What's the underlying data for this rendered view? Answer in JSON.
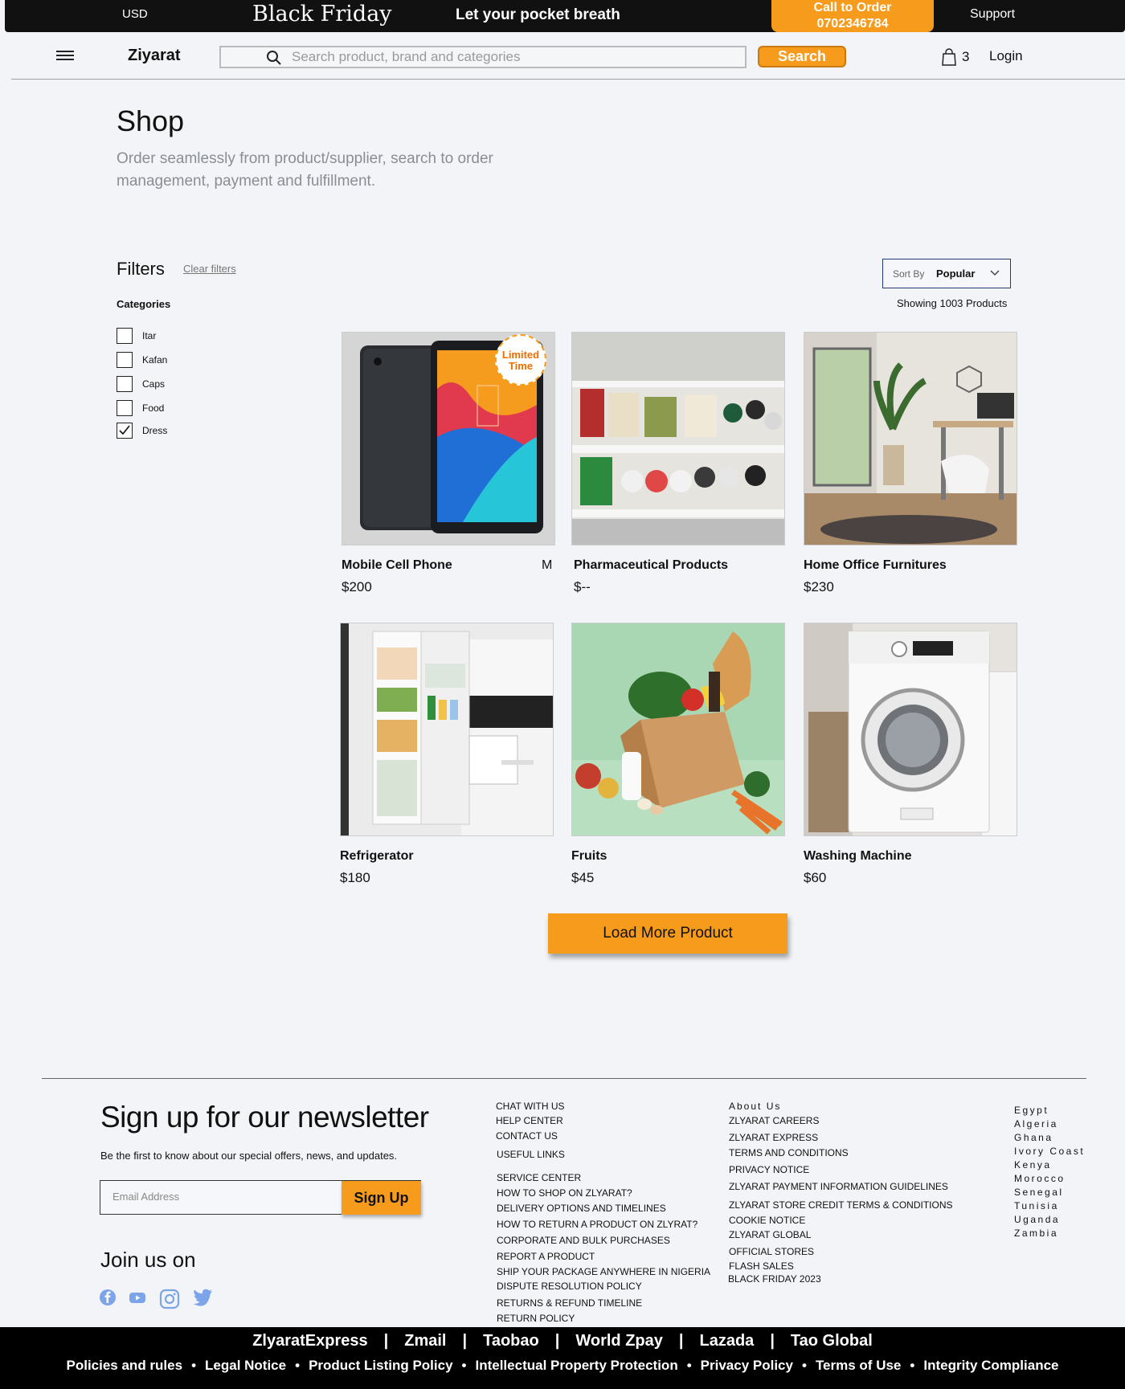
{
  "topbar": {
    "currency": "USD",
    "promo": "Black Friday",
    "tagline": "Let your pocket breath",
    "call_label": "Call to Order",
    "call_number": "0702346784",
    "support": "Support"
  },
  "nav": {
    "brand": "Ziyarat",
    "search_placeholder": "Search product, brand and categories",
    "search_button": "Search",
    "cart_count": "3",
    "login": "Login"
  },
  "hero": {
    "title": "Shop",
    "subtitle": "Order seamlessly from product/supplier, search to order management, payment and fulfillment."
  },
  "filters": {
    "title": "Filters",
    "clear": "Clear filters",
    "categories_title": "Categories",
    "categories": [
      {
        "label": "Itar",
        "checked": false
      },
      {
        "label": "Kafan",
        "checked": false
      },
      {
        "label": "Caps",
        "checked": false
      },
      {
        "label": "Food",
        "checked": false
      },
      {
        "label": "Dress",
        "checked": true
      }
    ]
  },
  "sort": {
    "label": "Sort By",
    "value": "Popular",
    "showing": "Showing 1003 Products"
  },
  "products": [
    {
      "name": "Mobile Cell Phone",
      "price": "$200",
      "extra": "M",
      "badge": "Limited Time"
    },
    {
      "name": "Pharmaceutical Products",
      "price": "$--"
    },
    {
      "name": "Home Office Furnitures",
      "price": "$230"
    },
    {
      "name": "Refrigerator",
      "price": "$180"
    },
    {
      "name": "Fruits",
      "price": "$45"
    },
    {
      "name": "Washing Machine",
      "price": "$60"
    }
  ],
  "load_more": "Load More Product",
  "newsletter": {
    "title": "Sign up for our newsletter",
    "subtitle": "Be the first to know about our special offers, news, and updates.",
    "email_placeholder": "Email Address",
    "signup": "Sign Up",
    "join": "Join us on"
  },
  "footer_col1": [
    "CHAT WITH US",
    "HELP CENTER",
    "CONTACT US",
    "USEFUL LINKS",
    "SERVICE CENTER",
    "HOW TO SHOP ON  ZLYARAT?",
    "DELIVERY OPTIONS AND TIMELINES",
    "HOW TO RETURN A PRODUCT ON ZLYRAT?",
    "CORPORATE AND BULK PURCHASES",
    "REPORT A PRODUCT",
    "SHIP YOUR PACKAGE ANYWHERE IN NIGERIA",
    "DISPUTE RESOLUTION POLICY",
    "RETURNS & REFUND TIMELINE",
    "RETURN POLICY"
  ],
  "footer_col2": [
    "About Us",
    "ZLYARAT CAREERS",
    "ZLYARAT EXPRESS",
    "TERMS AND CONDITIONS",
    "PRIVACY NOTICE",
    "ZLYARAT PAYMENT INFORMATION GUIDELINES",
    "ZLYARAT STORE CREDIT TERMS & CONDITIONS",
    "COOKIE NOTICE",
    "ZLYARAT GLOBAL",
    "OFFICIAL STORES",
    "FLASH SALES",
    "BLACK FRIDAY 2023"
  ],
  "countries": [
    "Egypt",
    "Algeria",
    "Ghana",
    "Ivory Coast",
    "Kenya",
    "Morocco",
    "Senegal",
    "Tunisia",
    "Uganda",
    "Zambia"
  ],
  "bottom": {
    "partners": [
      "ZlyaratExpress",
      "Zmail",
      "Taobao",
      "World Zpay",
      "Lazada",
      "Tao Global"
    ],
    "policies": [
      "Policies and rules",
      "Legal Notice",
      "Product Listing Policy",
      "Intellectual Property Protection",
      "Privacy Policy",
      "Terms of Use",
      "Integrity Compliance"
    ]
  },
  "colors": {
    "accent": "#f69b1c",
    "dark": "#111111",
    "background": "#f2f4f7"
  },
  "icons": [
    "menu-icon",
    "search-icon",
    "bag-icon",
    "chevron-down-icon",
    "checkmark-icon",
    "facebook-icon",
    "youtube-icon",
    "instagram-icon",
    "twitter-icon"
  ]
}
